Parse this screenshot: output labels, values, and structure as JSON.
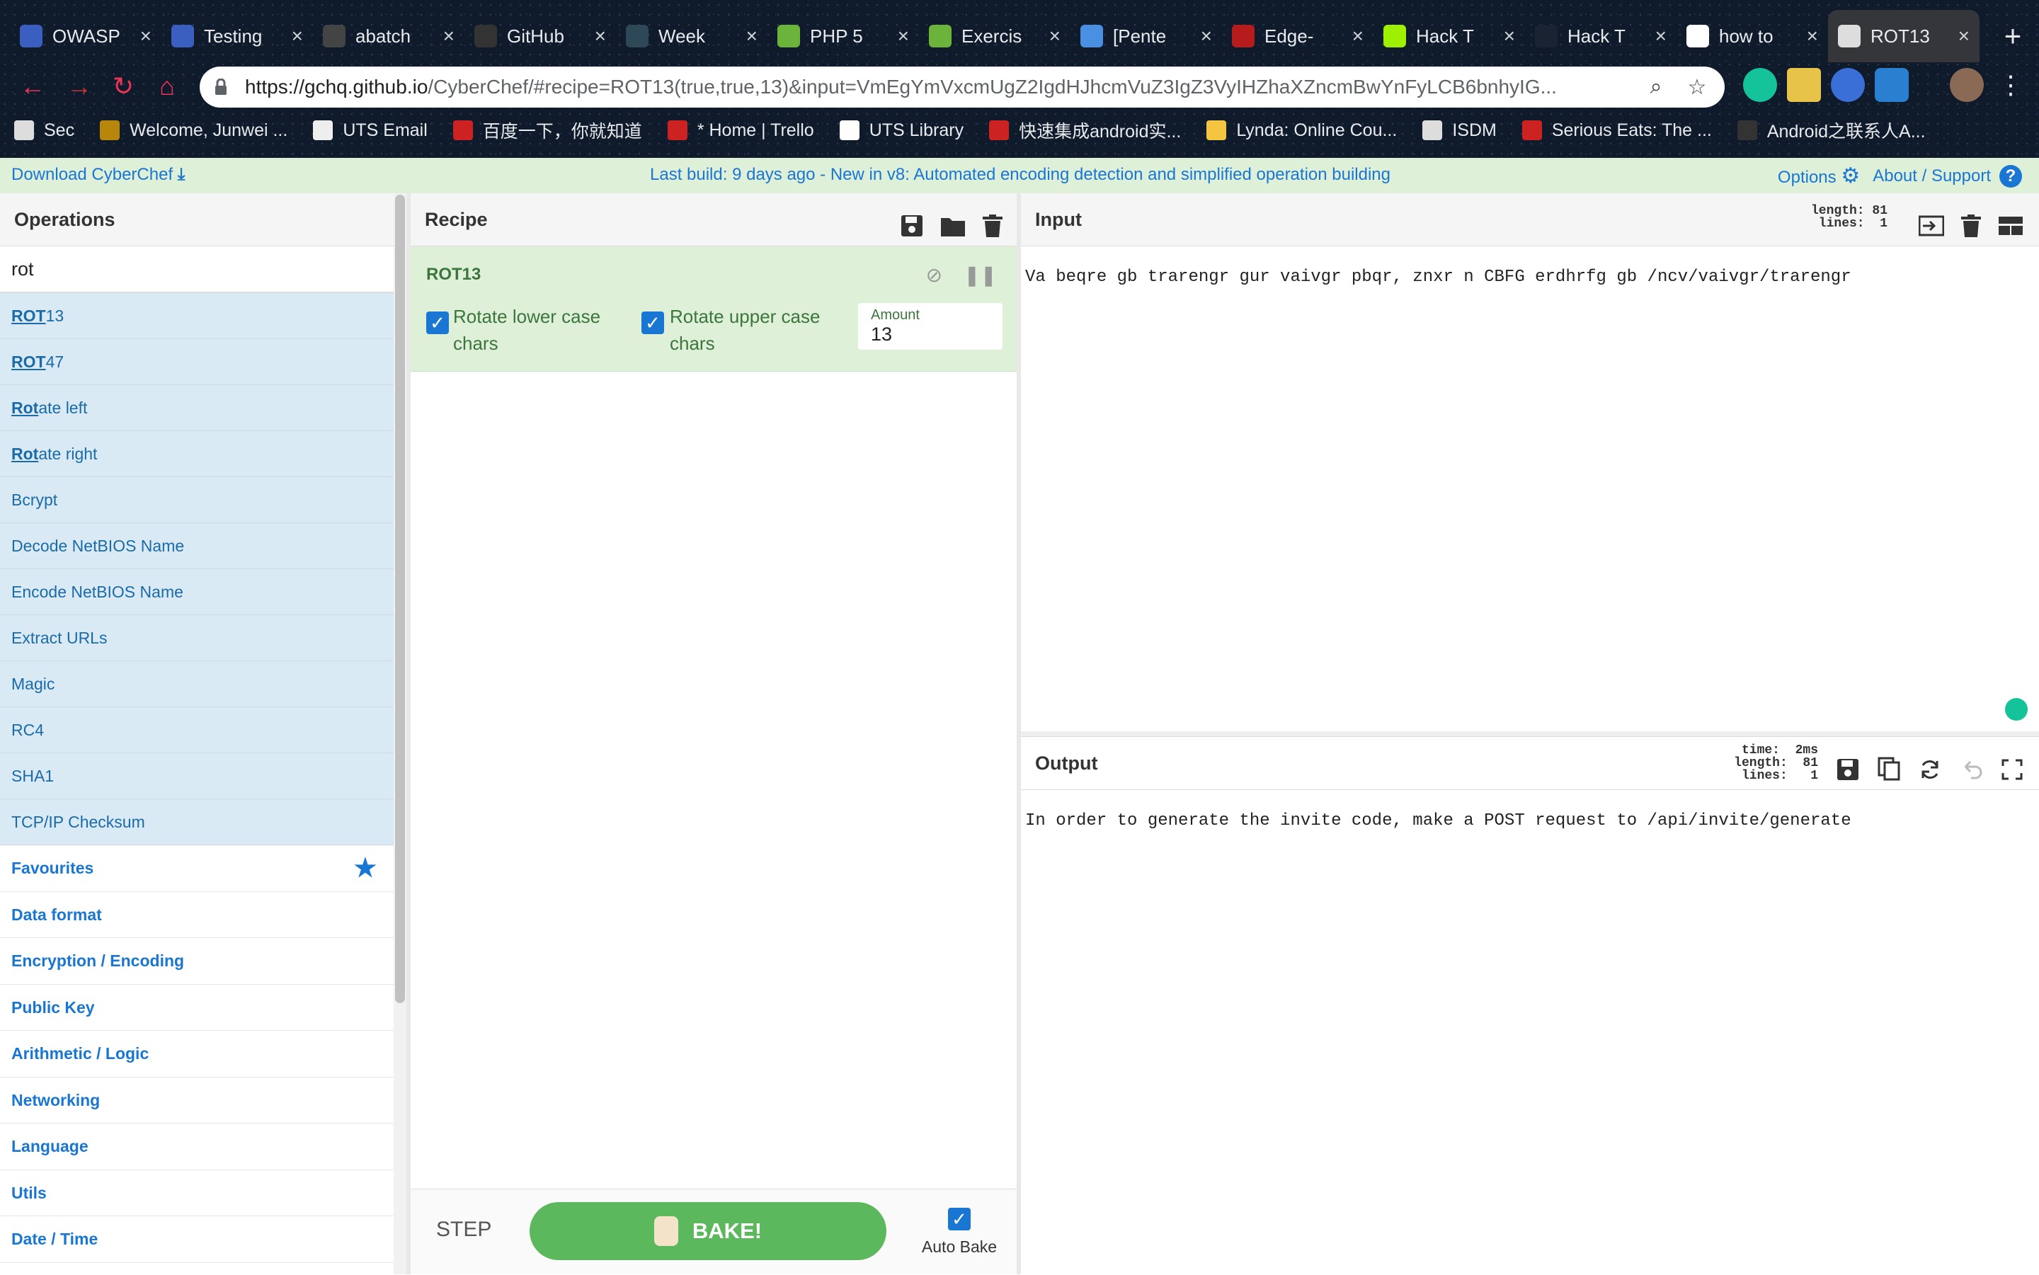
{
  "browser": {
    "tabs": [
      {
        "title": "OWASP",
        "color": "#3b5fc0"
      },
      {
        "title": "Testing",
        "color": "#3b5fc0"
      },
      {
        "title": "abatch",
        "color": "#444444"
      },
      {
        "title": "GitHub",
        "color": "#333333"
      },
      {
        "title": "Week",
        "color": "#2f4858"
      },
      {
        "title": "PHP 5",
        "color": "#6bb33a"
      },
      {
        "title": "Exercis",
        "color": "#6bb33a"
      },
      {
        "title": "[Pente",
        "color": "#4a90e2"
      },
      {
        "title": "Edge-",
        "color": "#b71c1c"
      },
      {
        "title": "Hack T",
        "color": "#9fef00"
      },
      {
        "title": "Hack T",
        "color": "#1a2332"
      },
      {
        "title": "how to",
        "color": "#ffffff"
      },
      {
        "title": "ROT13",
        "color": "#dddddd"
      }
    ],
    "url_host": "https://gchq.github.io",
    "url_rest": "/CyberChef/#recipe=ROT13(true,true,13)&input=VmEgYmVxcmUgZ2IgdHJhcmVuZ3IgZ3VyIHZhaXZncmBwYnFyLCB6bnhyIG...",
    "bookmarks": [
      "Sec",
      "Welcome, Junwei ...",
      "UTS Email",
      "百度一下，你就知道",
      "* Home | Trello",
      "UTS Library",
      "快速集成android实...",
      "Lynda: Online Cou...",
      "ISDM",
      "Serious Eats: The ...",
      "Android之联系人A..."
    ]
  },
  "banner": {
    "download": "Download CyberChef",
    "message": "Last build: 9 days ago - New in v8: Automated encoding detection and simplified operation building",
    "options": "Options",
    "about": "About / Support"
  },
  "operations": {
    "title": "Operations",
    "search_value": "rot",
    "results": [
      {
        "match": "ROT",
        "rest": "13"
      },
      {
        "match": "ROT",
        "rest": "47"
      },
      {
        "match": "Rot",
        "rest": "ate left"
      },
      {
        "match": "Rot",
        "rest": "ate right"
      },
      {
        "match": "",
        "rest": "Bcrypt"
      },
      {
        "match": "",
        "rest": "Decode NetBIOS Name"
      },
      {
        "match": "",
        "rest": "Encode NetBIOS Name"
      },
      {
        "match": "",
        "rest": "Extract URLs"
      },
      {
        "match": "",
        "rest": "Magic"
      },
      {
        "match": "",
        "rest": "RC4"
      },
      {
        "match": "",
        "rest": "SHA1"
      },
      {
        "match": "",
        "rest": "TCP/IP Checksum"
      }
    ],
    "categories": [
      "Favourites",
      "Data format",
      "Encryption / Encoding",
      "Public Key",
      "Arithmetic / Logic",
      "Networking",
      "Language",
      "Utils",
      "Date / Time"
    ]
  },
  "recipe": {
    "title": "Recipe",
    "op_name": "ROT13",
    "lower_label": "Rotate lower case chars",
    "upper_label": "Rotate upper case chars",
    "amount_label": "Amount",
    "amount_value": "13",
    "step": "STEP",
    "bake": "BAKE!",
    "auto_bake": "Auto Bake"
  },
  "input": {
    "title": "Input",
    "length": "81",
    "lines": "1",
    "text": "Va beqre gb trarengr gur vaivgr pbqr, znxr n CBFG erdhrfg gb /ncv/vaivgr/trarengr"
  },
  "output": {
    "title": "Output",
    "time": "2ms",
    "length": "81",
    "lines": "1",
    "text": "In order to generate the invite code, make a POST request to /api/invite/generate"
  }
}
